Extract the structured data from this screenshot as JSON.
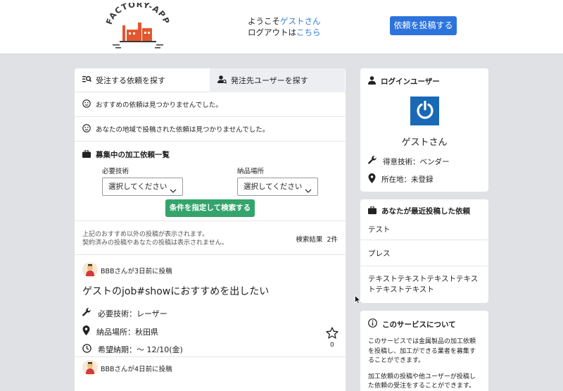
{
  "header": {
    "logo_text": "FACTORY-APP",
    "greeting_prefix": "ようこそ",
    "greeting_name": "ゲストさん",
    "logout_prefix": "ログアウトは",
    "logout_link": "こちら",
    "post_button": "依頼を投稿する"
  },
  "main": {
    "tabs": [
      {
        "label": "受注する依頼を探す",
        "icon": "search-list-icon"
      },
      {
        "label": "発注先ユーザーを探す",
        "icon": "user-search-icon"
      }
    ],
    "notices": [
      "おすすめの依頼は見つかりませんでした。",
      "あなたの地域で投稿された依頼は見つかりませんでした。"
    ],
    "recruit": {
      "title": "募集中の加工依頼一覧",
      "skill_label": "必要技術",
      "skill_value": "選択してください",
      "place_label": "納品場所",
      "place_value": "選択してください",
      "search_button": "条件を指定して検索する"
    },
    "results": {
      "note_line1": "上記のおすすめ以外の投稿が表示されます。",
      "note_line2": "契約済みの投稿やあなたの投稿は表示されません。",
      "count_label": "検索結果",
      "count_value": "2件"
    },
    "posts": [
      {
        "poster": "BBBさんが3日前に投稿",
        "title": "ゲストのjob#showにおすすめを出したい",
        "skill": "必要技術：レーザー",
        "place": "納品場所：秋田県",
        "deadline": "希望納期：～ 12/10(金)",
        "favorites": "0"
      },
      {
        "poster": "BBBさんが4日前に投稿"
      }
    ]
  },
  "login_card": {
    "title": "ログインユーザー",
    "name": "ゲストさん",
    "skill": "得意技術：ベンダー",
    "location": "所在地：未登録"
  },
  "recent_card": {
    "title": "あなたが最近投稿した依頼",
    "items": [
      "テスト",
      "プレス",
      "テキストテキストテキストテキストテキストテキスト"
    ]
  },
  "about_card": {
    "title": "このサービスについて",
    "para1": "このサービスでは金属製品の加工依頼を投稿し、加工ができる業者を募集することができます。",
    "para2": "加工依頼の投稿や他ユーザーが投稿した依頼の受注をすることができます。"
  },
  "colors": {
    "primary": "#2c73dc",
    "success": "#34a46c",
    "link": "#2e7fd1",
    "background": "#dfe1e5"
  }
}
